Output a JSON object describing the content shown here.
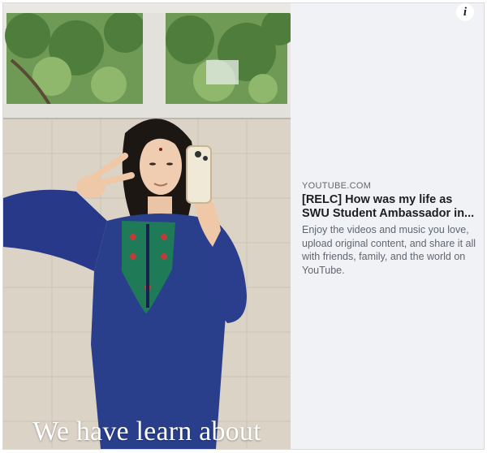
{
  "link_preview": {
    "thumbnail": {
      "alt": "",
      "caption": "We have learn about"
    },
    "domain": "YOUTUBE.COM",
    "title": "[RELC] How was my life as SWU Student Ambassador in...",
    "description": "Enjoy the videos and music you love, upload original content, and share it all with friends, family, and the world on YouTube.",
    "info_button": {
      "icon": "info-icon",
      "glyph": "i"
    }
  },
  "colors": {
    "card_background": "#f0f2f5",
    "title_text": "#1c1e21",
    "secondary_text": "#606770",
    "dress_blue": "#2a3f8c"
  }
}
